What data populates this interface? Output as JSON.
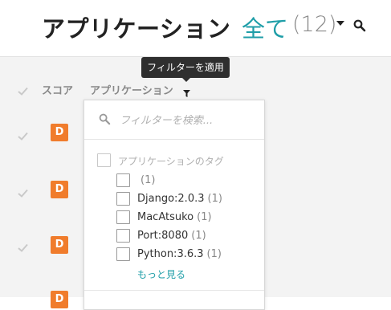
{
  "header": {
    "title": "アプリケーション",
    "filter_all": "全て",
    "count": "(12)"
  },
  "tooltip": {
    "text": "フィルターを適用"
  },
  "table": {
    "col_score": "スコア",
    "col_app": "アプリケーション",
    "rows": [
      {
        "grade": "D"
      },
      {
        "grade": "D"
      },
      {
        "grade": "D"
      },
      {
        "grade": "D"
      }
    ]
  },
  "filter_dropdown": {
    "search_placeholder": "フィルターを検索...",
    "group_label": "アプリケーションのタグ",
    "items": [
      {
        "label": "",
        "count": "(1)"
      },
      {
        "label": "Django:2.0.3",
        "count": "(1)"
      },
      {
        "label": "MacAtsuko",
        "count": "(1)"
      },
      {
        "label": "Port:8080",
        "count": "(1)"
      },
      {
        "label": "Python:3.6.3",
        "count": "(1)"
      }
    ],
    "more_link": "もっと見る"
  },
  "colors": {
    "accent": "#1f9ea8",
    "grade_badge": "#f07c2c",
    "tooltip_bg": "#2f2f2f"
  },
  "icons": {
    "search": "search-icon",
    "caret": "chevron-down-icon",
    "filter": "filter-icon",
    "check": "check-icon"
  }
}
